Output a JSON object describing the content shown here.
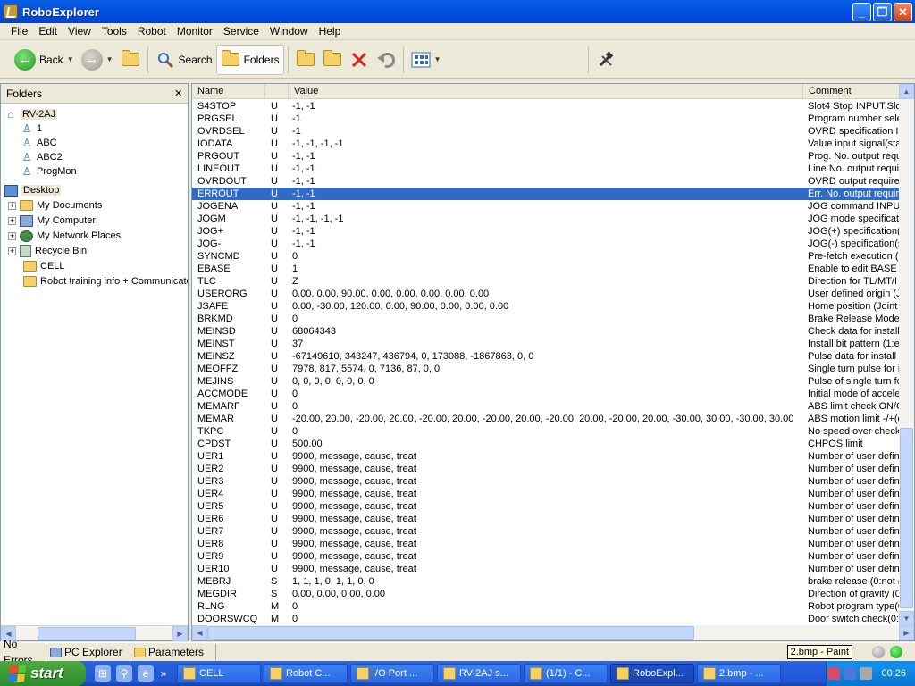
{
  "window": {
    "title": "RoboExplorer"
  },
  "menu": [
    "File",
    "Edit",
    "View",
    "Tools",
    "Robot",
    "Monitor",
    "Service",
    "Window",
    "Help"
  ],
  "toolbar": {
    "back": "Back",
    "search": "Search",
    "folders": "Folders"
  },
  "folders_pane": {
    "header": "Folders",
    "close": "×",
    "robot_root": "RV-2AJ",
    "robot_items": [
      "1",
      "ABC",
      "ABC2",
      "ProgMon"
    ],
    "desktop": "Desktop",
    "desktop_items": [
      "My Documents",
      "My Computer",
      "My Network Places",
      "Recycle Bin",
      "CELL",
      "Robot training info + Communicato"
    ]
  },
  "list": {
    "columns": {
      "name": "Name",
      "type": "",
      "value": "Value",
      "comment": "Comment"
    },
    "rows": [
      {
        "name": "S4STOP",
        "type": "U",
        "value": "-1, -1",
        "comment": "Slot4 Stop INPUT,Slo"
      },
      {
        "name": "PRGSEL",
        "type": "U",
        "value": "-1",
        "comment": "Program number sele"
      },
      {
        "name": "OVRDSEL",
        "type": "U",
        "value": "-1",
        "comment": "OVRD specification II"
      },
      {
        "name": "IODATA",
        "type": "U",
        "value": "-1, -1, -1, -1",
        "comment": "Value input signal(sta"
      },
      {
        "name": "PRGOUT",
        "type": "U",
        "value": "-1, -1",
        "comment": "Prog. No. output requ"
      },
      {
        "name": "LINEOUT",
        "type": "U",
        "value": "-1, -1",
        "comment": "Line No. output requir"
      },
      {
        "name": "OVRDOUT",
        "type": "U",
        "value": "-1, -1",
        "comment": "OVRD output requirer"
      },
      {
        "name": "ERROUT",
        "type": "U",
        "value": "-1, -1",
        "comment": "Err. No. output require"
      },
      {
        "name": "JOGENA",
        "type": "U",
        "value": "-1, -1",
        "comment": "JOG command INPUT"
      },
      {
        "name": "JOGM",
        "type": "U",
        "value": "-1, -1, -1, -1",
        "comment": "JOG mode specificati"
      },
      {
        "name": "JOG+",
        "type": "U",
        "value": "-1, -1",
        "comment": "JOG(+) specification(s"
      },
      {
        "name": "JOG-",
        "type": "U",
        "value": "-1, -1",
        "comment": "JOG(-) specification(s"
      },
      {
        "name": "SYNCMD",
        "type": "U",
        "value": "0",
        "comment": "Pre-fetch execution ("
      },
      {
        "name": "EBASE",
        "type": "U",
        "value": "1",
        "comment": "Enable to edit BASE p"
      },
      {
        "name": "TLC",
        "type": "U",
        "value": "Z",
        "comment": "Direction for TL/MT/I"
      },
      {
        "name": "USERORG",
        "type": "U",
        "value": "0.00, 0.00, 90.00, 0.00, 0.00, 0.00, 0.00, 0.00",
        "comment": "User defined origin (Jo"
      },
      {
        "name": "JSAFE",
        "type": "U",
        "value": "0.00, -30.00, 120.00, 0.00, 90.00, 0.00, 0.00, 0.00",
        "comment": "Home position (Joint c"
      },
      {
        "name": "BRKMD",
        "type": "U",
        "value": "0",
        "comment": "Brake Release Mode"
      },
      {
        "name": "MEINSD",
        "type": "U",
        "value": "68064343",
        "comment": "Check data for install"
      },
      {
        "name": "MEINST",
        "type": "U",
        "value": "37",
        "comment": "Install bit pattern (1:er"
      },
      {
        "name": "MEINSZ",
        "type": "U",
        "value": "-67149610, 343247, 436794, 0, 173088, -1867863, 0, 0",
        "comment": "Pulse data for install"
      },
      {
        "name": "MEOFFZ",
        "type": "U",
        "value": "7978, 817, 5574, 0, 7136, 87, 0, 0",
        "comment": "Single turn pulse for in"
      },
      {
        "name": "MEJINS",
        "type": "U",
        "value": "0, 0, 0, 0, 0, 0, 0, 0",
        "comment": "Pulse of single turn fo"
      },
      {
        "name": "ACCMODE",
        "type": "U",
        "value": "0",
        "comment": "Initial mode of accele"
      },
      {
        "name": "MEMARF",
        "type": "U",
        "value": "0",
        "comment": "ABS limit check ON/O"
      },
      {
        "name": "MEMAR",
        "type": "U",
        "value": "-20.00, 20.00, -20.00, 20.00, -20.00, 20.00, -20.00, 20.00, -20.00, 20.00, -20.00, 20.00, -30.00, 30.00, -30.00, 30.00",
        "comment": "ABS motion limit -/+(d"
      },
      {
        "name": "TKPC",
        "type": "U",
        "value": "0",
        "comment": "No speed over check"
      },
      {
        "name": "CPDST",
        "type": "U",
        "value": "500.00",
        "comment": "CHPOS limit"
      },
      {
        "name": "UER1",
        "type": "U",
        "value": "9900, message, cause, treat",
        "comment": "Number of user define"
      },
      {
        "name": "UER2",
        "type": "U",
        "value": "9900, message, cause, treat",
        "comment": "Number of user define"
      },
      {
        "name": "UER3",
        "type": "U",
        "value": "9900, message, cause, treat",
        "comment": "Number of user define"
      },
      {
        "name": "UER4",
        "type": "U",
        "value": "9900, message, cause, treat",
        "comment": "Number of user define"
      },
      {
        "name": "UER5",
        "type": "U",
        "value": "9900, message, cause, treat",
        "comment": "Number of user define"
      },
      {
        "name": "UER6",
        "type": "U",
        "value": "9900, message, cause, treat",
        "comment": "Number of user define"
      },
      {
        "name": "UER7",
        "type": "U",
        "value": "9900, message, cause, treat",
        "comment": "Number of user define"
      },
      {
        "name": "UER8",
        "type": "U",
        "value": "9900, message, cause, treat",
        "comment": "Number of user define"
      },
      {
        "name": "UER9",
        "type": "U",
        "value": "9900, message, cause, treat",
        "comment": "Number of user define"
      },
      {
        "name": "UER10",
        "type": "U",
        "value": "9900, message, cause, treat",
        "comment": "Number of user define"
      },
      {
        "name": "MEBRJ",
        "type": "S",
        "value": "1, 1, 1, 0, 1, 1, 0, 0",
        "comment": "brake release (0:not a"
      },
      {
        "name": "MEGDIR",
        "type": "S",
        "value": "0.00, 0.00, 0.00, 0.00",
        "comment": "Direction of gravity (0"
      },
      {
        "name": "RLNG",
        "type": "M",
        "value": "0",
        "comment": "Robot program type(0"
      },
      {
        "name": "DOORSWCQ",
        "type": "M",
        "value": "0",
        "comment": "Door switch check(0:"
      }
    ],
    "selected_index": 7
  },
  "statusbar": {
    "errors": "No Errors",
    "pc_explorer": "PC Explorer",
    "parameters": "Parameters",
    "tooltip": "2.bmp - Paint"
  },
  "taskbar": {
    "start": "start",
    "tasks": [
      "CELL",
      "Robot C...",
      "I/O Port ...",
      "RV-2AJ s...",
      "(1/1) - C...",
      "RoboExpl...",
      "2.bmp - ..."
    ],
    "active_task": 5,
    "clock": "00:26"
  }
}
